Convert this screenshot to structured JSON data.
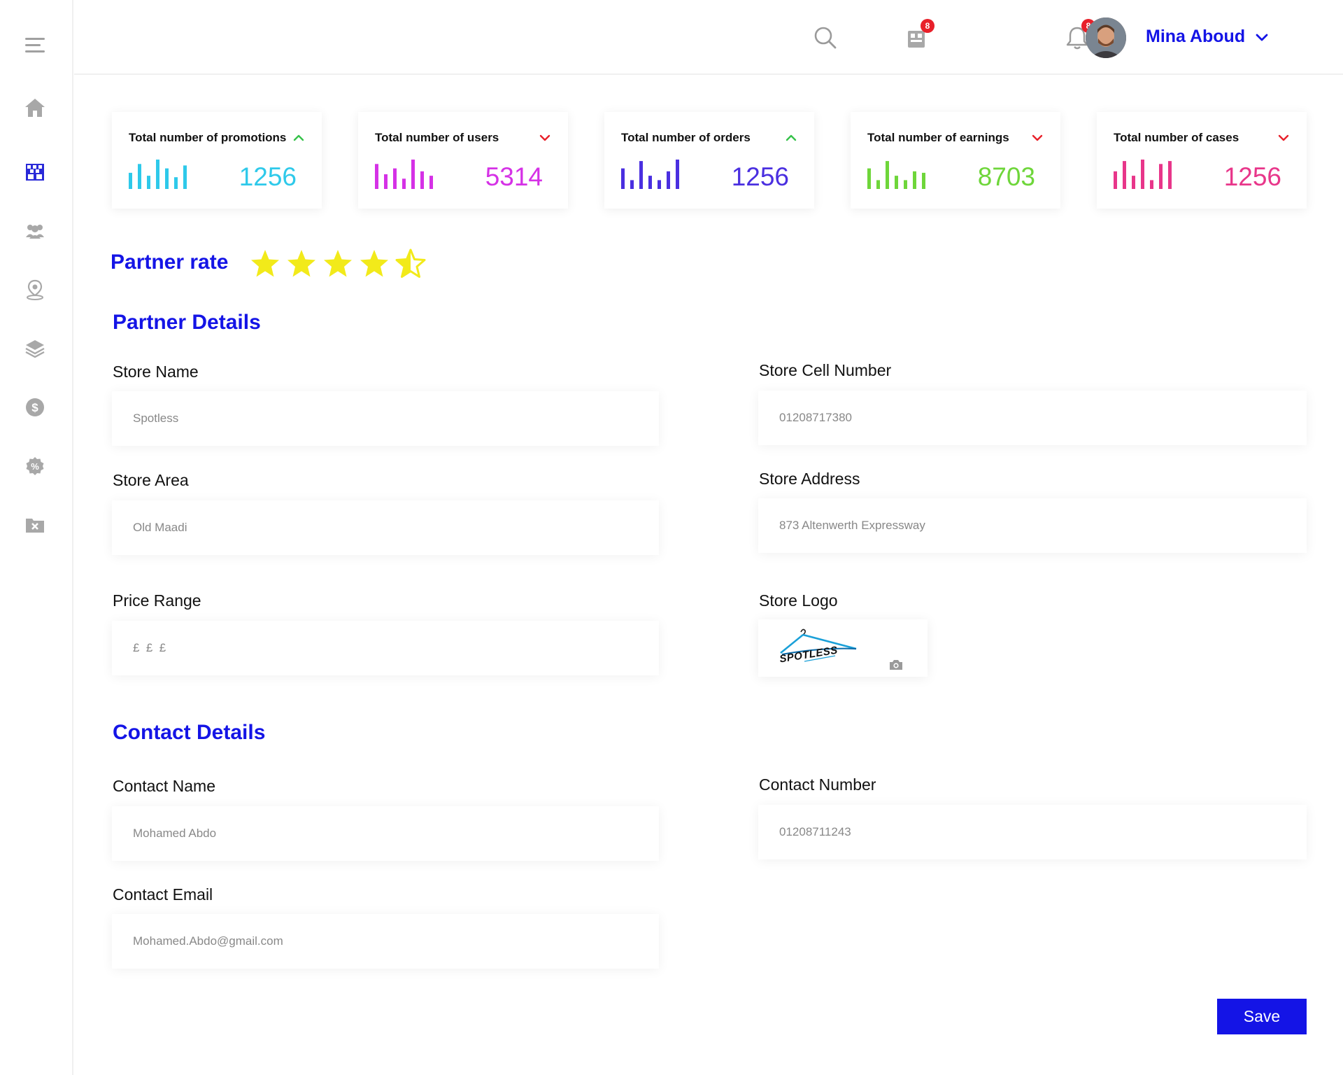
{
  "user": {
    "name": "Mina Aboud",
    "badges": {
      "orders": "8",
      "notifications": "8"
    }
  },
  "stats": [
    {
      "title": "Total number of promotions",
      "value": "1256",
      "trend": "up",
      "color": "#2ec9ea",
      "trend_color": "#36c24a",
      "bars": [
        0.55,
        0.85,
        0.45,
        1.0,
        0.7,
        0.4,
        0.8
      ]
    },
    {
      "title": "Total number of users",
      "value": "5314",
      "trend": "down",
      "color": "#d531e6",
      "trend_color": "#e8202a",
      "bars": [
        0.85,
        0.5,
        0.7,
        0.35,
        1.0,
        0.6,
        0.45
      ]
    },
    {
      "title": "Total number of orders",
      "value": "1256",
      "trend": "up",
      "color": "#4a2fe0",
      "trend_color": "#36c24a",
      "bars": [
        0.7,
        0.3,
        0.95,
        0.45,
        0.3,
        0.6,
        1.0
      ]
    },
    {
      "title": "Total number of earnings",
      "value": "8703",
      "trend": "down",
      "color": "#6ed63a",
      "trend_color": "#e8202a",
      "bars": [
        0.7,
        0.3,
        0.95,
        0.45,
        0.3,
        0.6,
        0.55
      ]
    },
    {
      "title": "Total number of cases",
      "value": "1256",
      "trend": "down",
      "color": "#e8368a",
      "trend_color": "#e8202a",
      "bars": [
        0.6,
        0.95,
        0.45,
        1.0,
        0.3,
        0.85,
        0.95
      ]
    }
  ],
  "partner_rate": {
    "label": "Partner rate",
    "rating": 4.5,
    "max": 5,
    "star_color": "#f2ea1a"
  },
  "partner_details": {
    "title": "Partner Details",
    "store_name": {
      "label": "Store Name",
      "value": "Spotless"
    },
    "store_cell": {
      "label": "Store Cell Number",
      "value": "01208717380"
    },
    "store_area": {
      "label": "Store Area",
      "value": "Old Maadi"
    },
    "store_address": {
      "label": "Store Address",
      "value": "873 Altenwerth Expressway"
    },
    "price_range": {
      "label": "Price Range",
      "value": "£  £  £"
    },
    "store_logo": {
      "label": "Store Logo",
      "logo_text": "SPOTLESS"
    }
  },
  "contact_details": {
    "title": "Contact Details",
    "contact_name": {
      "label": "Contact Name",
      "value": "Mohamed Abdo"
    },
    "contact_number": {
      "label": "Contact Number",
      "value": "01208711243"
    },
    "contact_email": {
      "label": "Contact Email",
      "value": "Mohamed.Abdo@gmail.com"
    }
  },
  "actions": {
    "save_label": "Save"
  },
  "colors": {
    "accent": "#1414e6",
    "icon_gray": "#a0a0a0"
  },
  "icons": [
    "menu-icon",
    "home-icon",
    "store-icon",
    "users-icon",
    "location-icon",
    "layers-icon",
    "dollar-icon",
    "percent-icon",
    "cancel-folder-icon",
    "search-icon",
    "orders-icon",
    "bell-icon",
    "chevron-down-icon",
    "camera-icon",
    "star-icon"
  ]
}
